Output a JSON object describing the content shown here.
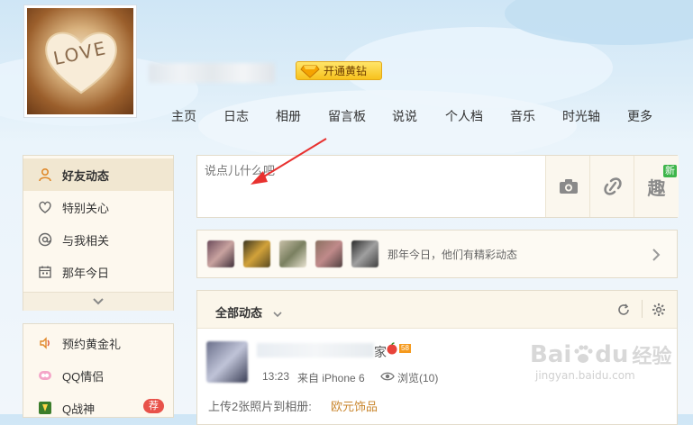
{
  "profile": {
    "avatar_text": "LOVE",
    "vip_button": "开通黄钻"
  },
  "nav": [
    "主页",
    "日志",
    "相册",
    "留言板",
    "说说",
    "个人档",
    "音乐",
    "时光轴",
    "更多"
  ],
  "sidebar": {
    "items": [
      {
        "label": "好友动态",
        "icon": "person-icon"
      },
      {
        "label": "特别关心",
        "icon": "heart-icon"
      },
      {
        "label": "与我相关",
        "icon": "at-icon"
      },
      {
        "label": "那年今日",
        "icon": "calendar-icon"
      }
    ],
    "apps": [
      {
        "label": "预约黄金礼",
        "icon": "speaker-icon"
      },
      {
        "label": "QQ情侣",
        "icon": "couple-icon"
      },
      {
        "label": "Q战神",
        "icon": "game-icon",
        "badge": "荐"
      }
    ]
  },
  "composer": {
    "placeholder": "说点儿什么吧",
    "new_tag": "新",
    "fun_label": "趣"
  },
  "memories": {
    "text": "那年今日，他们有精彩动态"
  },
  "feed": {
    "filter": "全部动态",
    "post": {
      "time": "13:23",
      "source": "来自 iPhone 6",
      "views": "浏览(10)",
      "level": "58",
      "suffix": "家",
      "body_prefix": "上传2张照片到相册:",
      "album_link": "欧元饰品"
    }
  },
  "watermark": {
    "brand": "Bai",
    "brand2": "du",
    "jingyan": "经验",
    "url": "jingyan.baidu.com"
  },
  "colors": {
    "accent": "#f7c21d",
    "link": "#c9862e",
    "annotation": "#e8312f"
  }
}
